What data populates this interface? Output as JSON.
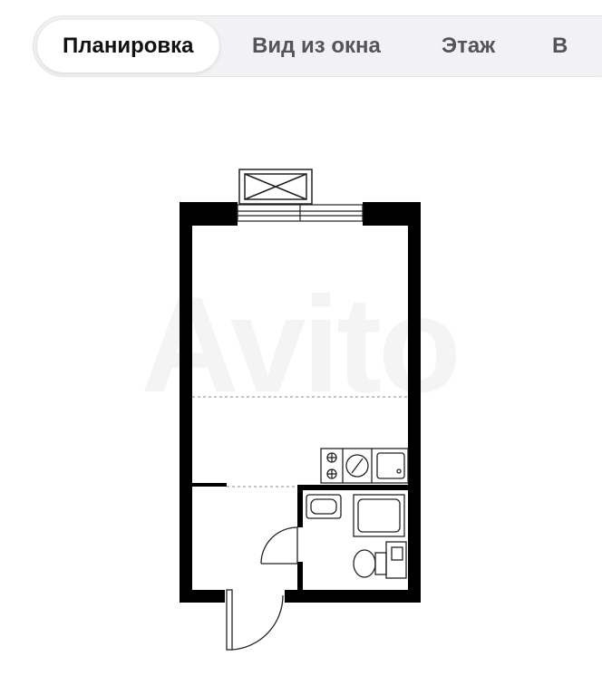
{
  "tabs": [
    {
      "label": "Планировка",
      "active": true
    },
    {
      "label": "Вид из окна",
      "active": false
    },
    {
      "label": "Этаж",
      "active": false
    },
    {
      "label": "В",
      "active": false
    }
  ],
  "watermark": "Avito",
  "colors": {
    "wall": "#000000",
    "tab_bar": "#f2f2f4",
    "tab_active": "#ffffff",
    "tab_text_active": "#111111",
    "tab_text": "#555558"
  }
}
